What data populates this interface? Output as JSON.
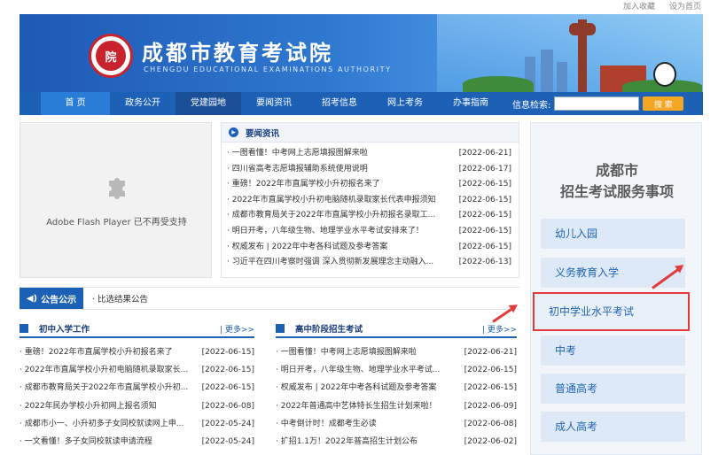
{
  "header": {
    "title": "成都市教育考试院",
    "subtitle": "CHENGDU EDUCATIONAL EXAMINATIONS AUTHORITY",
    "logo_text": "院",
    "top_links": [
      "加入收藏",
      "设为首页"
    ]
  },
  "nav": {
    "items": [
      "首 页",
      "政务公开",
      "党建园地",
      "要闻资讯",
      "招考信息",
      "网上考务",
      "办事指南"
    ],
    "search_label": "信息检索:",
    "search_placeholder": "",
    "search_button": "搜 索"
  },
  "flash": {
    "message": "Adobe Flash Player 已不再受支持"
  },
  "news": {
    "title": "要闻资讯",
    "items": [
      {
        "title": "· 一图看懂！中考网上志愿填报图解来啦",
        "date": "[2022-06-21]"
      },
      {
        "title": "· 四川省高考志愿填报辅助系统使用说明",
        "date": "[2022-06-17]"
      },
      {
        "title": "· 重磅！2022年市直属学校小升初报名来了",
        "date": "[2022-06-15]"
      },
      {
        "title": "· 2022年市直属学校小升初电脑随机录取家长代表申报须知",
        "date": "[2022-06-15]"
      },
      {
        "title": "· 成都市教育局关于2022年市直属学校小升初报名录取工...",
        "date": "[2022-06-15]"
      },
      {
        "title": "· 明日开考，八年级生物、地理学业水平考试安排来了！",
        "date": "[2022-06-15]"
      },
      {
        "title": "· 权威发布 | 2022年中考各科试题及参考答案",
        "date": "[2022-06-15]"
      },
      {
        "title": "· 习近平在四川考察时强调 深入贯彻新发展理念主动融入...",
        "date": "[2022-06-13]"
      }
    ]
  },
  "notice": {
    "tag": "公告公示",
    "item": "· 比选结果公告"
  },
  "sections": {
    "left": {
      "title": "初中入学工作",
      "more": "| 更多>>",
      "items": [
        {
          "title": "· 重磅！2022年市直属学校小升初报名来了",
          "date": "[2022-06-15]"
        },
        {
          "title": "· 2022年市直属学校小升初电脑随机录取家长...",
          "date": "[2022-06-15]"
        },
        {
          "title": "· 成都市教育局关于2022年市直属学校小升初...",
          "date": "[2022-06-15]"
        },
        {
          "title": "· 2022年民办学校小升初网上报名须知",
          "date": "[2022-06-08]"
        },
        {
          "title": "· 成都市小一、小升初多子女同校就读网上申...",
          "date": "[2022-05-24]"
        },
        {
          "title": "· 一文看懂！多子女同校就读申请流程",
          "date": "[2022-05-24]"
        }
      ]
    },
    "right": {
      "title": "高中阶段招生考试",
      "more": "| 更多>>",
      "items": [
        {
          "title": "· 一图看懂！中考网上志愿填报图解来啦",
          "date": "[2022-06-21]"
        },
        {
          "title": "· 明日开考，八年级生物、地理学业水平考试...",
          "date": "[2022-06-15]"
        },
        {
          "title": "· 权威发布 | 2022年中考各科试题及参考答案",
          "date": "[2022-06-15]"
        },
        {
          "title": "· 2022年普通高中艺体特长生招生计划来啦！",
          "date": "[2022-06-09]"
        },
        {
          "title": "· 中考倒计时！成都考生必读",
          "date": "[2022-06-08]"
        },
        {
          "title": "· 扩招1.1万！2022年普高招生计划公布",
          "date": "[2022-06-02]"
        }
      ]
    }
  },
  "services": {
    "title_line1": "成都市",
    "title_line2": "招生考试服务事项",
    "items": [
      "幼儿入园",
      "义务教育入学",
      "初中学业水平考试",
      "中考",
      "普通高考",
      "成人高考"
    ],
    "highlighted_index": 2
  },
  "colors": {
    "primary": "#1d61b7",
    "highlight": "#e23b3b",
    "search_button": "#f5a623"
  }
}
